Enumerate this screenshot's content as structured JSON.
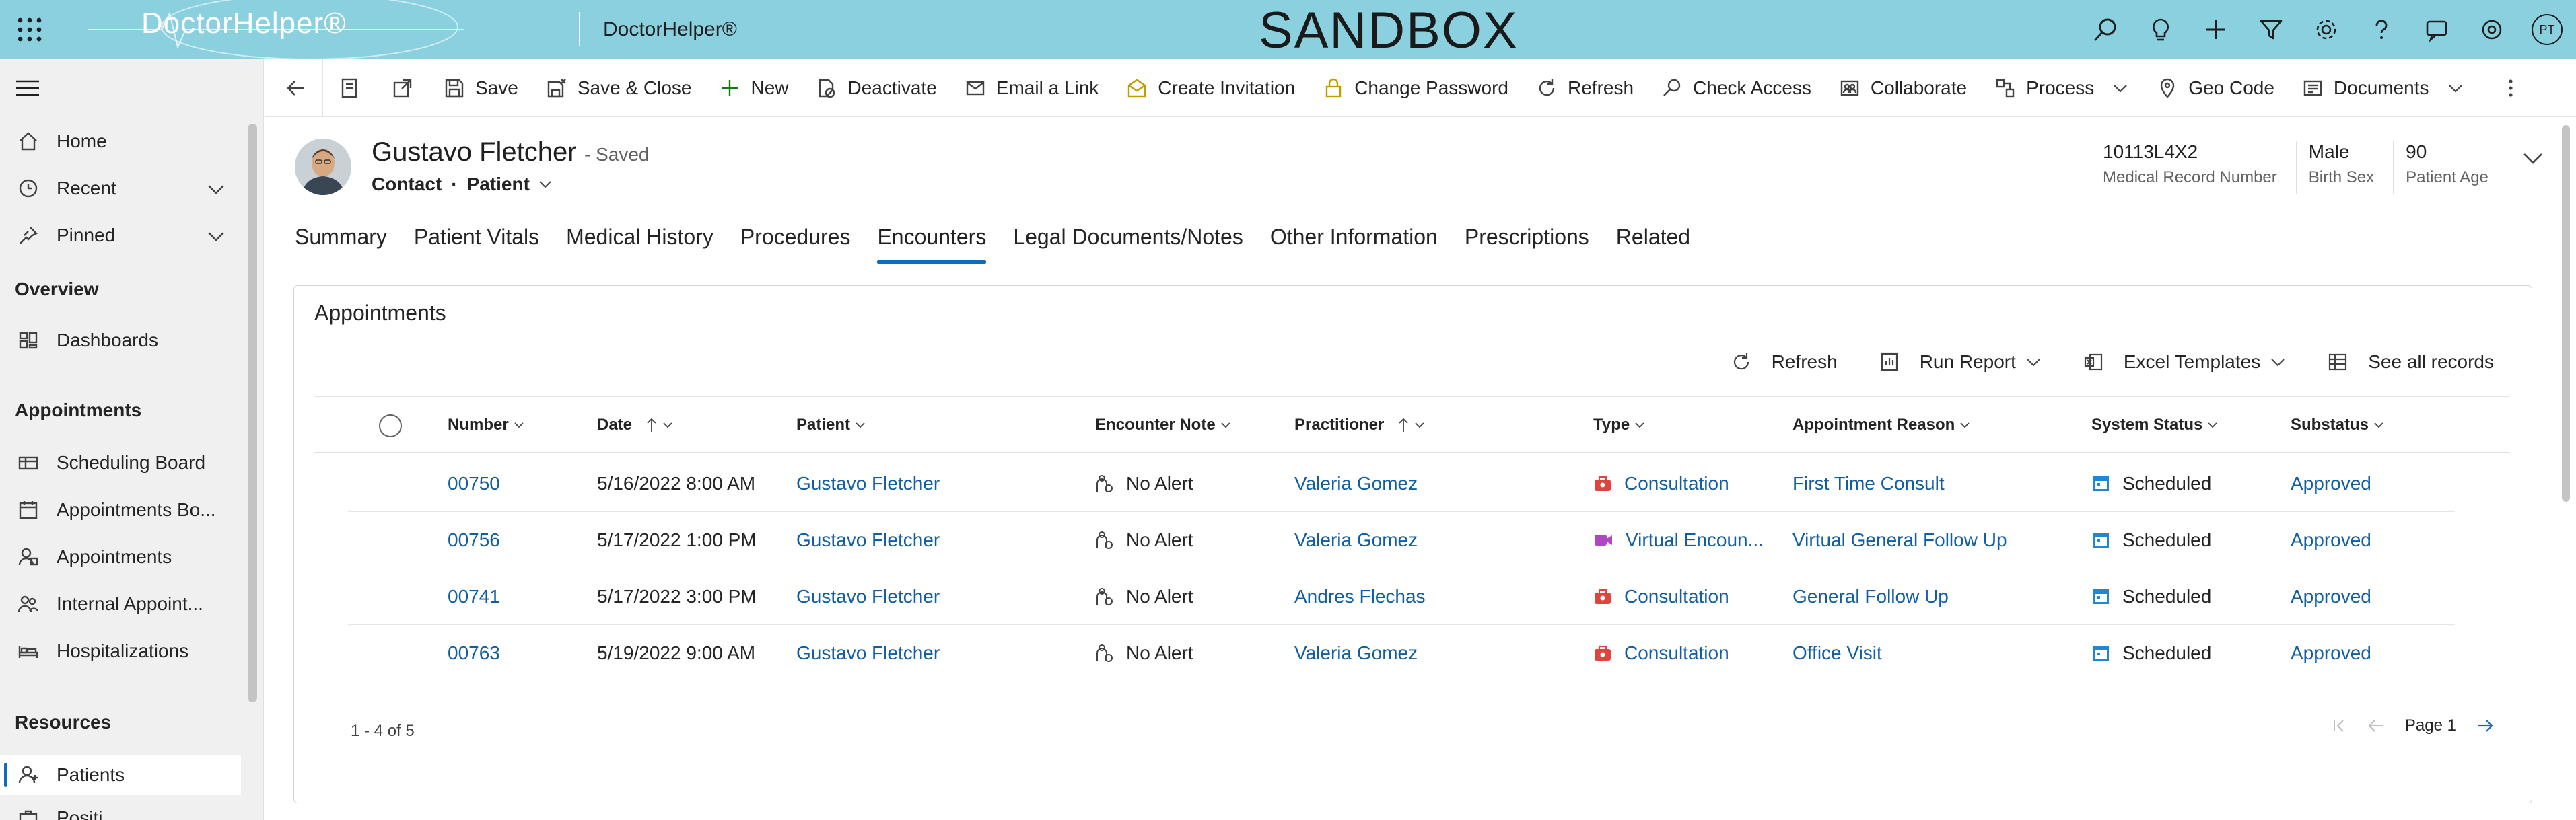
{
  "header": {
    "logo_text": "DoctorHelper®",
    "app_name": "DoctorHelper®",
    "environment": "SANDBOX",
    "user_initials": "PT"
  },
  "nav": {
    "home": "Home",
    "recent": "Recent",
    "pinned": "Pinned",
    "overview_group": "Overview",
    "dashboards": "Dashboards",
    "appointments_group": "Appointments",
    "scheduling_board": "Scheduling Board",
    "appointments_board": "Appointments Bo...",
    "appointments": "Appointments",
    "internal_appointments": "Internal Appoint...",
    "hospitalizations": "Hospitalizations",
    "resources_group": "Resources",
    "patients": "Patients",
    "positions": "Positi..."
  },
  "commands": {
    "save": "Save",
    "save_close": "Save & Close",
    "new": "New",
    "deactivate": "Deactivate",
    "email_link": "Email a Link",
    "create_invitation": "Create Invitation",
    "change_password": "Change Password",
    "refresh": "Refresh",
    "check_access": "Check Access",
    "collaborate": "Collaborate",
    "process": "Process",
    "geo_code": "Geo Code",
    "documents": "Documents"
  },
  "record": {
    "name": "Gustavo Fletcher",
    "saved_status": "- Saved",
    "entity": "Contact",
    "form": "Patient",
    "fields": [
      {
        "value": "10113L4X2",
        "label": "Medical Record Number"
      },
      {
        "value": "Male",
        "label": "Birth Sex"
      },
      {
        "value": "90",
        "label": "Patient Age"
      }
    ]
  },
  "tabs": [
    "Summary",
    "Patient Vitals",
    "Medical History",
    "Procedures",
    "Encounters",
    "Legal Documents/Notes",
    "Other Information",
    "Prescriptions",
    "Related"
  ],
  "active_tab": "Encounters",
  "appointments": {
    "title": "Appointments",
    "tools": {
      "refresh": "Refresh",
      "run_report": "Run Report",
      "excel_templates": "Excel Templates",
      "see_all": "See all records"
    },
    "columns": [
      "Number",
      "Date",
      "Patient",
      "Encounter Note",
      "Practitioner",
      "Type",
      "Appointment Reason",
      "System Status",
      "Substatus"
    ],
    "rows": [
      {
        "number": "00750",
        "date": "5/16/2022 8:00 AM",
        "patient": "Gustavo Fletcher",
        "note": "No Alert",
        "practitioner": "Valeria Gomez",
        "type": "Consultation",
        "type_icon": "briefcase-icon",
        "reason": "First Time Consult",
        "status": "Scheduled",
        "substatus": "Approved"
      },
      {
        "number": "00756",
        "date": "5/17/2022 1:00 PM",
        "patient": "Gustavo Fletcher",
        "note": "No Alert",
        "practitioner": "Valeria Gomez",
        "type": "Virtual Encoun...",
        "type_icon": "video-icon",
        "reason": "Virtual General Follow Up",
        "status": "Scheduled",
        "substatus": "Approved"
      },
      {
        "number": "00741",
        "date": "5/17/2022 3:00 PM",
        "patient": "Gustavo Fletcher",
        "note": "No Alert",
        "practitioner": "Andres Flechas",
        "type": "Consultation",
        "type_icon": "briefcase-icon",
        "reason": "General Follow Up",
        "status": "Scheduled",
        "substatus": "Approved"
      },
      {
        "number": "00763",
        "date": "5/19/2022 9:00 AM",
        "patient": "Gustavo Fletcher",
        "note": "No Alert",
        "practitioner": "Valeria Gomez",
        "type": "Consultation",
        "type_icon": "briefcase-icon",
        "reason": "Office Visit",
        "status": "Scheduled",
        "substatus": "Approved"
      }
    ],
    "count_text": "1 - 4 of 5",
    "page_text": "Page 1"
  },
  "colors": {
    "header_bg": "#8ad0de",
    "link": "#115ea3",
    "accent": "#0f6cbd",
    "consult_icon": "#e0443e",
    "video_icon": "#b146c2"
  }
}
